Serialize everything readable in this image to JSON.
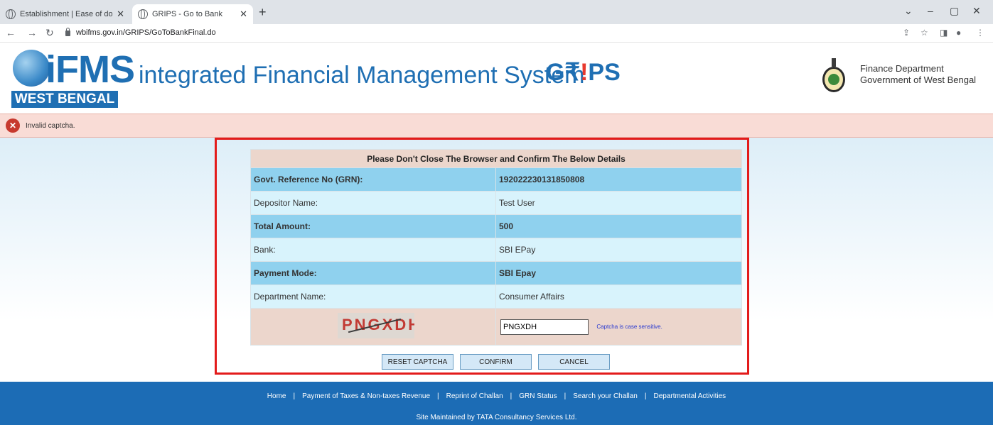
{
  "browser": {
    "tabs": [
      {
        "title": "Establishment | Ease of doing bu",
        "active": false
      },
      {
        "title": "GRIPS - Go to Bank",
        "active": true
      }
    ],
    "url": "wbifms.gov.in/GRIPS/GoToBankFinal.do"
  },
  "header": {
    "logo_text": "iFMS",
    "logo_band": "WEST BENGAL",
    "app_title": "integrated Financial Management System",
    "grips_pre": "G",
    "grips_mid": "₹",
    "grips_bang": "!",
    "grips_post": "PS",
    "dept_line1": "Finance Department",
    "dept_line2": "Government of West Bengal"
  },
  "alert": {
    "message": "Invalid captcha."
  },
  "form": {
    "heading": "Please Don't Close The Browser and Confirm The Below Details",
    "rows": [
      {
        "label": "Govt. Reference No (GRN):",
        "value": "192022230131850808"
      },
      {
        "label": "Depositor Name:",
        "value": "Test User"
      },
      {
        "label": "Total Amount:",
        "value": "500"
      },
      {
        "label": "Bank:",
        "value": "SBI EPay"
      },
      {
        "label": "Payment Mode:",
        "value": "SBI Epay"
      },
      {
        "label": "Department Name:",
        "value": "Consumer Affairs"
      }
    ],
    "captcha_image_text": "PNGXDH",
    "captcha_value": "PNGXDH",
    "captcha_note": "Captcha is case sensitive.",
    "buttons": {
      "reset": "RESET CAPTCHA",
      "confirm": "CONFIRM",
      "cancel": "CANCEL"
    }
  },
  "footer": {
    "links": [
      "Home",
      "Payment of Taxes & Non-taxes Revenue",
      "Reprint of Challan",
      "GRN Status",
      "Search your Challan",
      "Departmental Activities"
    ],
    "separator": "|",
    "note": "Site Maintained by TATA Consultancy Services Ltd."
  },
  "colors": {
    "brand_blue": "#1f6fb3",
    "error_red": "#e31b1b",
    "footer_blue": "#1c6cb5"
  }
}
